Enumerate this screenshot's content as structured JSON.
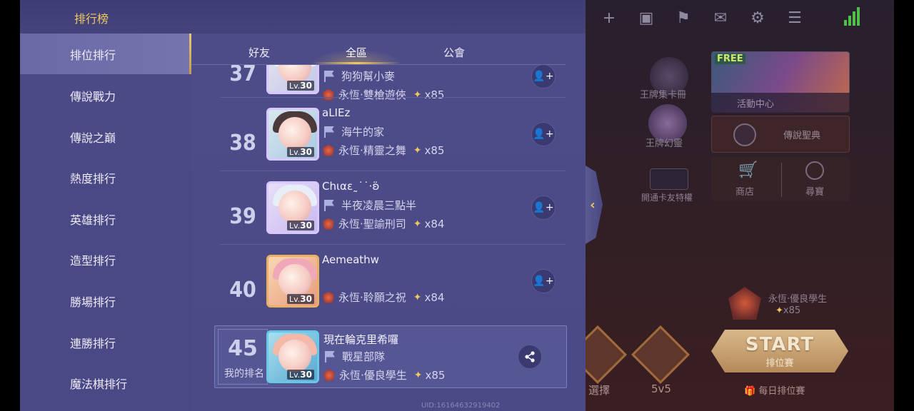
{
  "panel": {
    "title": "排行榜"
  },
  "sidebar": {
    "items": [
      {
        "label": "排位排行",
        "active": true
      },
      {
        "label": "傳說戰力",
        "active": false
      },
      {
        "label": "傳說之巔",
        "active": false
      },
      {
        "label": "熱度排行",
        "active": false
      },
      {
        "label": "英雄排行",
        "active": false
      },
      {
        "label": "造型排行",
        "active": false
      },
      {
        "label": "勝場排行",
        "active": false
      },
      {
        "label": "連勝排行",
        "active": false
      },
      {
        "label": "魔法棋排行",
        "active": false
      }
    ]
  },
  "tabs": [
    {
      "label": "好友",
      "active": false
    },
    {
      "label": "全區",
      "active": true
    },
    {
      "label": "公會",
      "active": false
    }
  ],
  "rows": [
    {
      "rank": "37",
      "name": "",
      "guild": "狗狗幫小麥",
      "tier": "永恆·雙槍遊俠",
      "stars": "x85",
      "level": "30"
    },
    {
      "rank": "38",
      "name": "aLIEz",
      "guild": "海牛的家",
      "tier": "永恆·精靈之舞",
      "stars": "x85",
      "level": "30"
    },
    {
      "rank": "39",
      "name": "Chιαɛ˷˙˙·ʚ̈",
      "guild": "半夜凌晨三點半",
      "tier": "永恆·聖諭刑司",
      "stars": "x84",
      "level": "30"
    },
    {
      "rank": "40",
      "name": "Aemeathw",
      "guild": "",
      "tier": "永恆·聆願之祝",
      "stars": "x84",
      "level": "30"
    }
  ],
  "my_rank": {
    "rank": "45",
    "label": "我的排名",
    "name": "現在輪克里希囉",
    "guild": "戰星部隊",
    "tier": "永恆·優良學生",
    "stars": "x85",
    "level": "30"
  },
  "lv_prefix": "Lv.",
  "uid": "UID:1616463291940​2",
  "lobby": {
    "card_book": "王牌集卡冊",
    "event_center": "活動中心",
    "free_badge": "FREE",
    "ace_spirit": "王牌幻靈",
    "legend_book": "傳說聖典",
    "card_pass": "開通卡友特權",
    "shop": "商店",
    "treasure": "尋寶",
    "player_tier": "永恆·優良學生",
    "player_stars": "x85",
    "mode_select": "選擇",
    "mode_5v5": "5v5",
    "start": "START",
    "start_sub": "排位賽",
    "daily": "每日排位賽"
  },
  "colors": {
    "accent_gold": "#f0c860",
    "panel_bg": "#4b4a86",
    "active_tab": "#7574ae"
  }
}
